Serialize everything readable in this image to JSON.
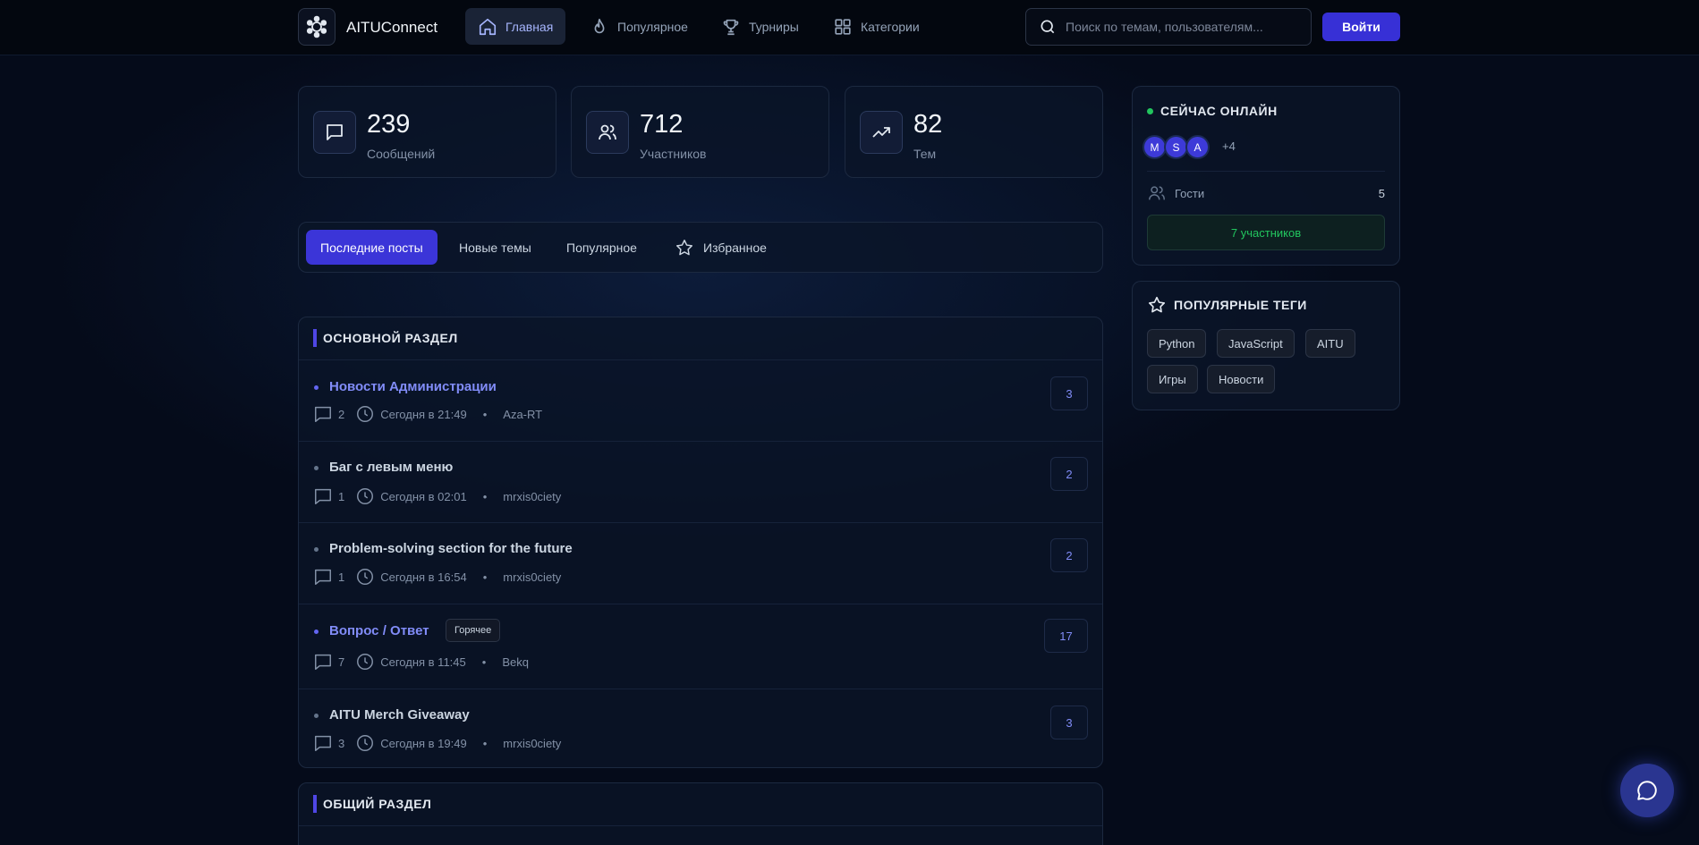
{
  "brand": {
    "name": "AITUConnect"
  },
  "nav": [
    {
      "label": "Главная",
      "icon": "home-icon",
      "active": true
    },
    {
      "label": "Популярное",
      "icon": "flame-icon"
    },
    {
      "label": "Турниры",
      "icon": "trophy-icon"
    },
    {
      "label": "Категории",
      "icon": "grid-icon"
    }
  ],
  "search": {
    "placeholder": "Поиск по темам, пользователям..."
  },
  "login": {
    "label": "Войти"
  },
  "stats": [
    {
      "value": "239",
      "label": "Сообщений",
      "icon": "message-icon"
    },
    {
      "value": "712",
      "label": "Участников",
      "icon": "users-icon"
    },
    {
      "value": "82",
      "label": "Тем",
      "icon": "trending-up-icon"
    }
  ],
  "tabs": [
    {
      "label": "Последние посты",
      "active": true
    },
    {
      "label": "Новые темы"
    },
    {
      "label": "Популярное"
    },
    {
      "label": "Избранное",
      "icon": "star-icon"
    }
  ],
  "sections": [
    {
      "title": "ОСНОВНОЙ РАЗДЕЛ",
      "topics": [
        {
          "title": "Новости Администрации",
          "comments": "2",
          "time": "Сегодня в 21:49",
          "author": "Aza-RT",
          "count": "3",
          "highlight": true
        },
        {
          "title": "Баг с левым меню",
          "comments": "1",
          "time": "Сегодня в 02:01",
          "author": "mrxis0ciety",
          "count": "2",
          "highlight": false
        },
        {
          "title": "Problem-solving section for the future",
          "comments": "1",
          "time": "Сегодня в 16:54",
          "author": "mrxis0ciety",
          "count": "2",
          "highlight": false
        },
        {
          "title": "Вопрос / Ответ",
          "tag": "Горячее",
          "comments": "7",
          "time": "Сегодня в 11:45",
          "author": "Bekq",
          "count": "17",
          "highlight": true
        },
        {
          "title": "AITU Merch Giveaway",
          "comments": "3",
          "time": "Сегодня в 19:49",
          "author": "mrxis0ciety",
          "count": "3",
          "highlight": false
        }
      ]
    },
    {
      "title": "ОБЩИЙ РАЗДЕЛ",
      "topics": []
    }
  ],
  "online": {
    "title": "СЕЙЧАС ОНЛАЙН",
    "avatars": [
      "M",
      "S",
      "A"
    ],
    "more": "+4",
    "guests_label": "Гости",
    "guests_value": "5",
    "members": "7 участников",
    "status_color": "#22c55e"
  },
  "popular_tags": {
    "title": "ПОПУЛЯРНЫЕ ТЕГИ",
    "tags": [
      "Python",
      "JavaScript",
      "AITU",
      "Игры",
      "Новости"
    ]
  },
  "colors": {
    "accent": "#3b35d8",
    "link": "#818cf8",
    "online": "#22c55e"
  }
}
